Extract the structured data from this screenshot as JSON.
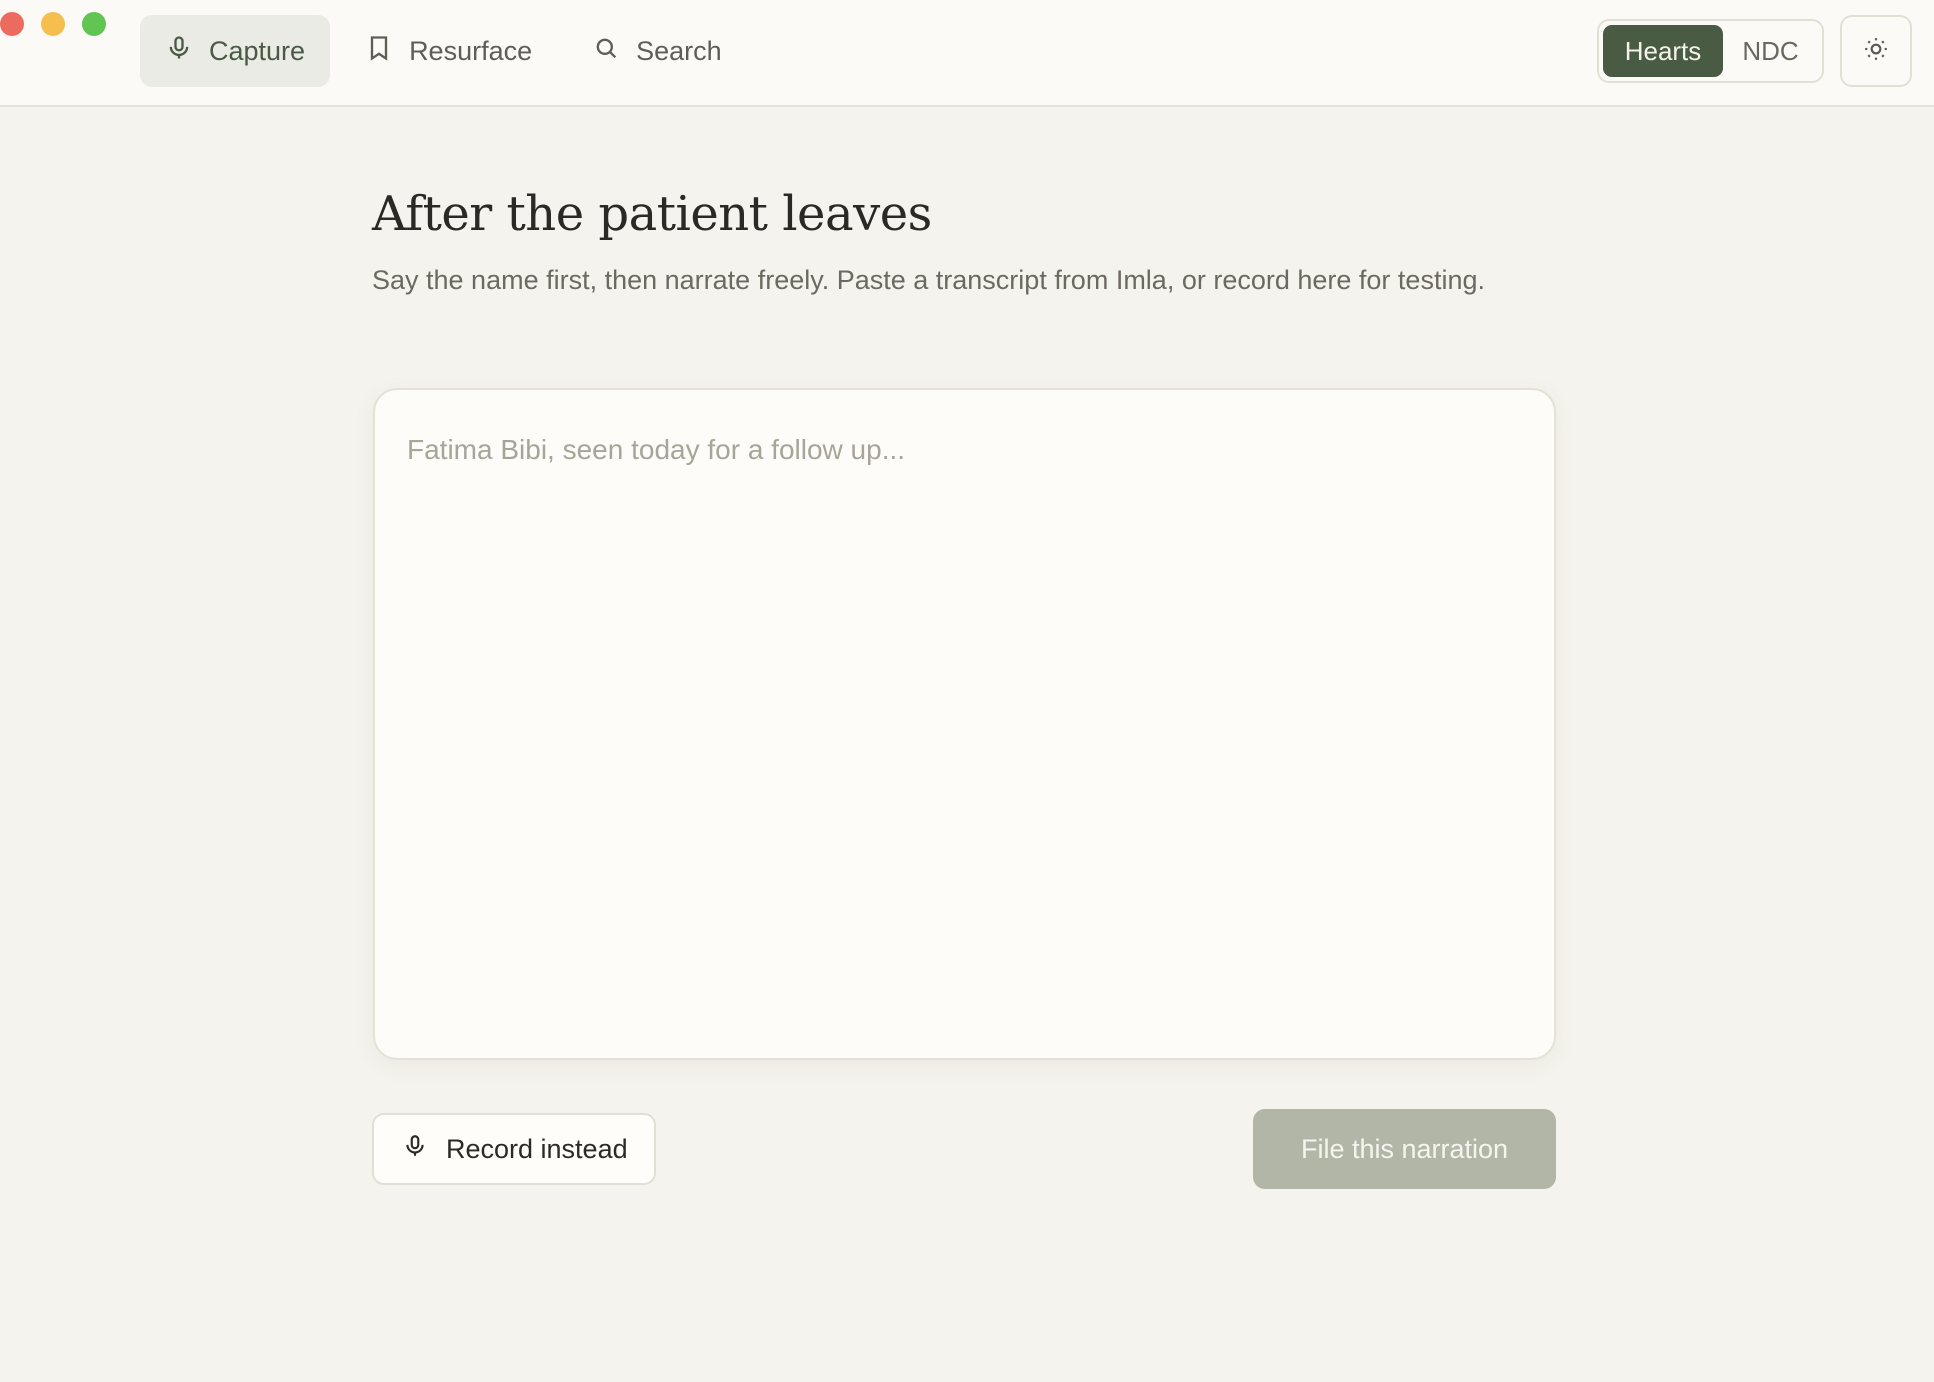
{
  "window": {
    "controls": [
      "close",
      "minimize",
      "zoom"
    ]
  },
  "nav": {
    "items": [
      {
        "label": "Capture",
        "icon": "microphone-icon",
        "active": true
      },
      {
        "label": "Resurface",
        "icon": "bookmark-icon",
        "active": false
      },
      {
        "label": "Search",
        "icon": "search-icon",
        "active": false
      }
    ]
  },
  "workspace_toggle": {
    "options": [
      "Hearts",
      "NDC"
    ],
    "selected": "Hearts"
  },
  "theme_toggle": {
    "icon": "sun-icon"
  },
  "main": {
    "title": "After the patient leaves",
    "subtitle": "Say the name first, then narrate freely. Paste a transcript from Imla, or record here for testing.",
    "narration": {
      "value": "",
      "placeholder": "Fatima Bibi, seen today for a follow up..."
    },
    "record_label": "Record instead",
    "submit_label": "File this narration"
  },
  "colors": {
    "accent": "#4a5b43",
    "background": "#f5f3ed",
    "submit_disabled": "#b2b6a7"
  }
}
